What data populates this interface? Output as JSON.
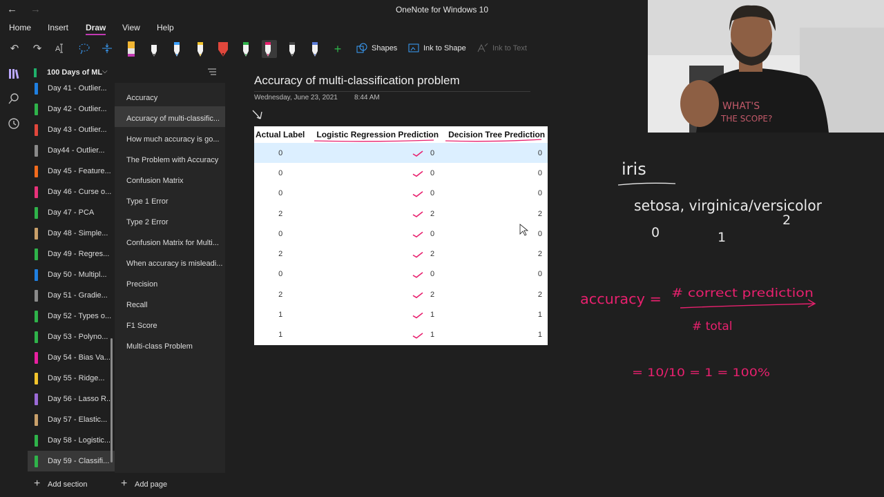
{
  "titlebar": {
    "title": "OneNote for Windows 10",
    "back": "←",
    "forward": "→"
  },
  "tabs": [
    "Home",
    "Insert",
    "Draw",
    "View",
    "Help"
  ],
  "toolbar": {
    "undo": "↶",
    "redo": "↷",
    "shapes_label": "Shapes",
    "ink_to_shape_label": "Ink to Shape",
    "ink_to_text_label": "Ink to Text",
    "add_pen": "+"
  },
  "notebook": {
    "name": "100 Days of ML"
  },
  "sections": [
    {
      "label": "Day 41 - Outlier...",
      "color": "#1f7fe0"
    },
    {
      "label": "Day 42 - Outlier...",
      "color": "#2fb34a"
    },
    {
      "label": "Day 43 - Outlier...",
      "color": "#e0473c"
    },
    {
      "label": "Day44 - Outlier...",
      "color": "#8a8a8a"
    },
    {
      "label": "Day 45 - Feature...",
      "color": "#f26b1d"
    },
    {
      "label": "Day 46 - Curse o...",
      "color": "#e8327a"
    },
    {
      "label": "Day 47 - PCA",
      "color": "#2fb34a"
    },
    {
      "label": "Day 48 - Simple...",
      "color": "#c9a06a"
    },
    {
      "label": "Day 49 - Regres...",
      "color": "#2fb34a"
    },
    {
      "label": "Day 50 - Multipl...",
      "color": "#1f7fe0"
    },
    {
      "label": "Day 51 - Gradie...",
      "color": "#8a8a8a"
    },
    {
      "label": "Day 52 - Types o...",
      "color": "#2fb34a"
    },
    {
      "label": "Day 53 - Polyno...",
      "color": "#2fb34a"
    },
    {
      "label": "Day 54 - Bias Va...",
      "color": "#e820a0"
    },
    {
      "label": "Day 55 - Ridge...",
      "color": "#f2c42c"
    },
    {
      "label": "Day 56 - Lasso R...",
      "color": "#9b6ad6"
    },
    {
      "label": "Day 57 - Elastic...",
      "color": "#c9a06a"
    },
    {
      "label": "Day 58 - Logistic...",
      "color": "#2fb34a"
    },
    {
      "label": "Day 59 - Classifi...",
      "color": "#2fb34a"
    }
  ],
  "pages": [
    "Accuracy",
    "Accuracy of multi-classific...",
    "How much accuracy is go...",
    "The Problem with Accuracy",
    "Confusion Matrix",
    "Type 1 Error",
    "Type 2 Error",
    "Confusion Matrix for Multi...",
    "When accuracy is misleadi...",
    "Precision",
    "Recall",
    "F1 Score",
    "Multi-class Problem"
  ],
  "bottom": {
    "add_section": "Add section",
    "add_page": "Add page"
  },
  "page": {
    "title": "Accuracy of multi-classification problem",
    "date": "Wednesday, June 23, 2021",
    "time": "8:44 AM"
  },
  "table": {
    "headers": [
      "Actual Label",
      "Logistic Regression Prediction",
      "Decision Tree Prediction"
    ],
    "rows": [
      [
        "0",
        "0",
        "0"
      ],
      [
        "0",
        "0",
        "0"
      ],
      [
        "0",
        "0",
        "0"
      ],
      [
        "2",
        "2",
        "2"
      ],
      [
        "0",
        "0",
        "0"
      ],
      [
        "2",
        "2",
        "2"
      ],
      [
        "0",
        "0",
        "0"
      ],
      [
        "2",
        "2",
        "2"
      ],
      [
        "1",
        "1",
        "1"
      ],
      [
        "1",
        "1",
        "1"
      ]
    ]
  },
  "ink_notes": {
    "iris": "iris",
    "classes": "setosa, virginica/versicolor",
    "codes": [
      "0",
      "1",
      "2"
    ],
    "accuracy": "accuracy =",
    "numerator": "# correct prediction",
    "denominator": "# total",
    "result": "= 10/10 = 1 = 100%"
  },
  "colors": {
    "accent": "#c239b3",
    "ink": "#e8206e",
    "highlight": "#dcefff"
  }
}
